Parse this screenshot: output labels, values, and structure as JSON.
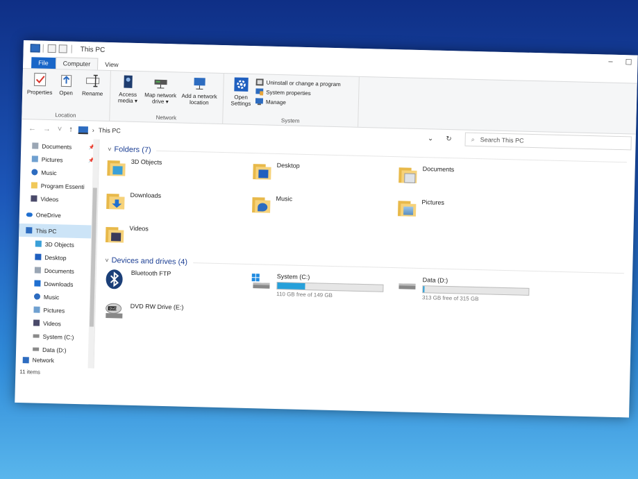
{
  "window": {
    "title": "This PC",
    "minimize": "–",
    "maximize": "☐"
  },
  "tabs": [
    "File",
    "Computer",
    "View"
  ],
  "ribbon": {
    "location": {
      "label": "Location",
      "buttons": [
        "Properties",
        "Open",
        "Rename"
      ]
    },
    "network": {
      "label": "Network",
      "buttons": [
        "Access media ▾",
        "Map network drive ▾",
        "Add a network location"
      ]
    },
    "system": {
      "label": "System",
      "open_settings": "Open Settings",
      "items": [
        "Uninstall or change a program",
        "System properties",
        "Manage"
      ]
    }
  },
  "address": {
    "path": "This PC",
    "search_placeholder": "Search This PC"
  },
  "nav": {
    "quick_access": [
      {
        "label": "Documents",
        "pinned": true
      },
      {
        "label": "Pictures",
        "pinned": true
      },
      {
        "label": "Music",
        "pinned": false
      },
      {
        "label": "Program Essenti",
        "pinned": false
      },
      {
        "label": "Videos",
        "pinned": false
      }
    ],
    "onedrive": "OneDrive",
    "this_pc": "This PC",
    "this_pc_children": [
      "3D Objects",
      "Desktop",
      "Documents",
      "Downloads",
      "Music",
      "Pictures",
      "Videos",
      "System (C:)",
      "Data (D:)"
    ],
    "network": "Network"
  },
  "folders": {
    "header": "Folders (7)",
    "items": [
      "3D Objects",
      "Desktop",
      "Documents",
      "Downloads",
      "Music",
      "Pictures",
      "Videos"
    ]
  },
  "devices": {
    "header": "Devices and drives (4)",
    "items": [
      {
        "name": "Bluetooth FTP"
      },
      {
        "name": "System (C:)",
        "free": "110 GB free of 149 GB",
        "used_fraction": 0.26
      },
      {
        "name": "Data (D:)",
        "free": "313 GB free of 315 GB",
        "used_fraction": 0.01
      },
      {
        "name": "DVD RW Drive (E:)"
      }
    ]
  },
  "status": {
    "items": "11 items"
  },
  "colors": {
    "accent": "#1966c8",
    "bar_fill": "#26a0da",
    "folder": "#f6d27a"
  }
}
